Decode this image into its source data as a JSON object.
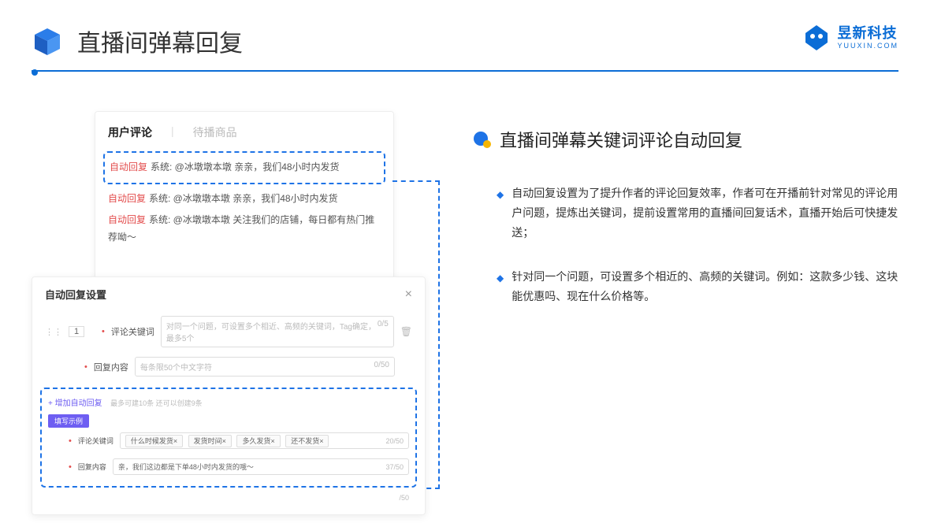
{
  "header": {
    "title": "直播间弹幕回复"
  },
  "brand": {
    "name": "昱新科技",
    "sub": "YUUXIN.COM"
  },
  "commentCard": {
    "tabs": {
      "active": "用户评论",
      "inactive": "待播商品"
    },
    "highlighted": {
      "tag": "自动回复",
      "text": "系统: @冰墩墩本墩 亲亲，我们48小时内发货"
    },
    "rows": [
      {
        "tag": "自动回复",
        "text": "系统: @冰墩墩本墩 亲亲，我们48小时内发货"
      },
      {
        "tag": "自动回复",
        "text": "系统: @冰墩墩本墩 关注我们的店铺，每日都有热门推荐呦～"
      }
    ]
  },
  "settingsCard": {
    "title": "自动回复设置",
    "indexValue": "1",
    "keywordLabel": "评论关键词",
    "keywordPlaceholder": "对同一个问题，可设置多个相近、高频的关键词，Tag确定，最多5个",
    "keywordCount": "0/5",
    "contentLabel": "回复内容",
    "contentPlaceholder": "每条限50个中文字符",
    "contentCount": "0/50",
    "addText": "+ 增加自动回复",
    "addHint": "最多可建10条 还可以创建9条",
    "exampleBadge": "填写示例",
    "exKeywordLabel": "评论关键词",
    "exTags": [
      "什么时候发货×",
      "发货时间×",
      "多久发货×",
      "还不发货×"
    ],
    "exKeywordCount": "20/50",
    "exContentLabel": "回复内容",
    "exContentValue": "亲，我们这边都是下单48小时内发货的哦～",
    "exContentCount": "37/50",
    "trailingCount": "/50"
  },
  "right": {
    "title": "直播间弹幕关键词评论自动回复",
    "bullets": [
      "自动回复设置为了提升作者的评论回复效率，作者可在开播前针对常见的评论用户问题，提炼出关键词，提前设置常用的直播间回复话术，直播开始后可快捷发送；",
      "针对同一个问题，可设置多个相近的、高频的关键词。例如：这款多少钱、这块能优惠吗、现在什么价格等。"
    ]
  }
}
